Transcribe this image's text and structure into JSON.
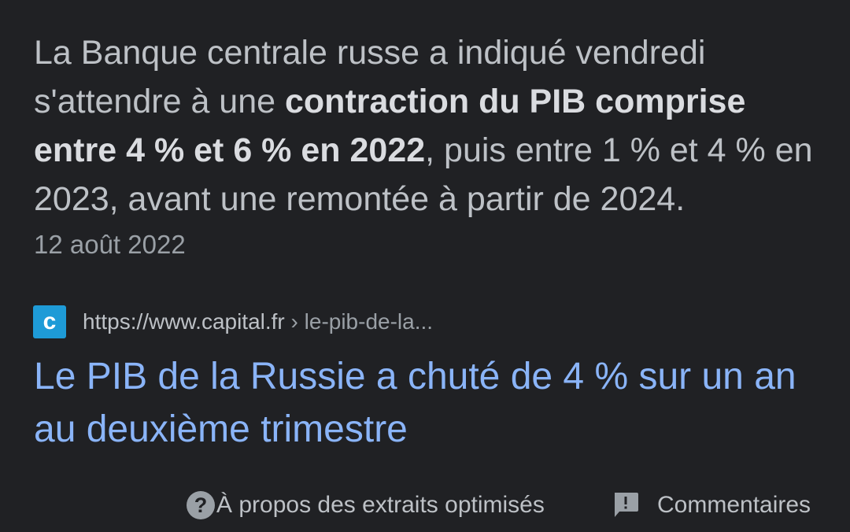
{
  "snippet": {
    "text_before": "La Banque centrale russe a indiqué vendredi s'attendre à une ",
    "text_bold": "contraction du PIB comprise entre 4 % et 6 % en 2022",
    "text_after": ", puis entre 1 % et 4 % en 2023, avant une remontée à partir de 2024.",
    "date": "12 août 2022"
  },
  "source": {
    "favicon_letter": "c",
    "url_domain": "https://www.capital.fr",
    "url_path": " › le-pib-de-la...",
    "favicon_color": "#1e9bd7"
  },
  "result": {
    "title": "Le PIB de la Russie a chuté de 4 % sur un an au deuxième trimestre",
    "title_color": "#8ab4f8"
  },
  "footer": {
    "help_icon_glyph": "?",
    "about_label": "À propos des extraits optimisés",
    "feedback_label": "Commentaires",
    "help_icon": "question-circle-icon",
    "feedback_icon": "feedback-icon"
  }
}
